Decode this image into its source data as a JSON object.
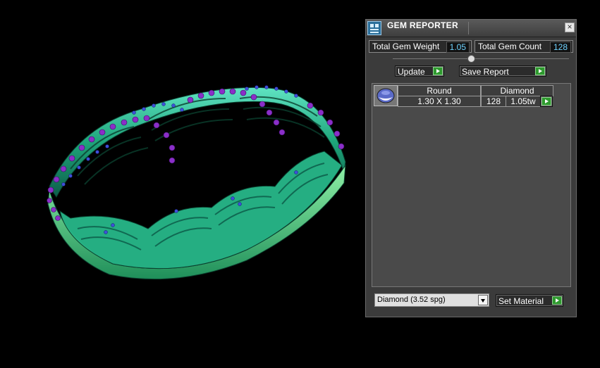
{
  "panel": {
    "title": "GEM REPORTER",
    "close_icon": "close-icon",
    "total_weight_label": "Total Gem Weight",
    "total_weight_value": "1.05",
    "total_count_label": "Total Gem Count",
    "total_count_value": "128",
    "update_label": "Update",
    "save_report_label": "Save Report",
    "gem_rows": [
      {
        "shape": "Round",
        "material": "Diamond",
        "size": "1.30 X 1.30",
        "count": "128",
        "weight": "1.05tw"
      }
    ],
    "material_select": "Diamond    (3.52 spg)",
    "set_material_label": "Set Material"
  },
  "colors": {
    "accent_green": "#2e9a2e",
    "value_text": "#6fd3ff",
    "metal": "#35c79a",
    "gem_purple": "#8a2fc8",
    "gem_blue": "#3f4fd8"
  }
}
